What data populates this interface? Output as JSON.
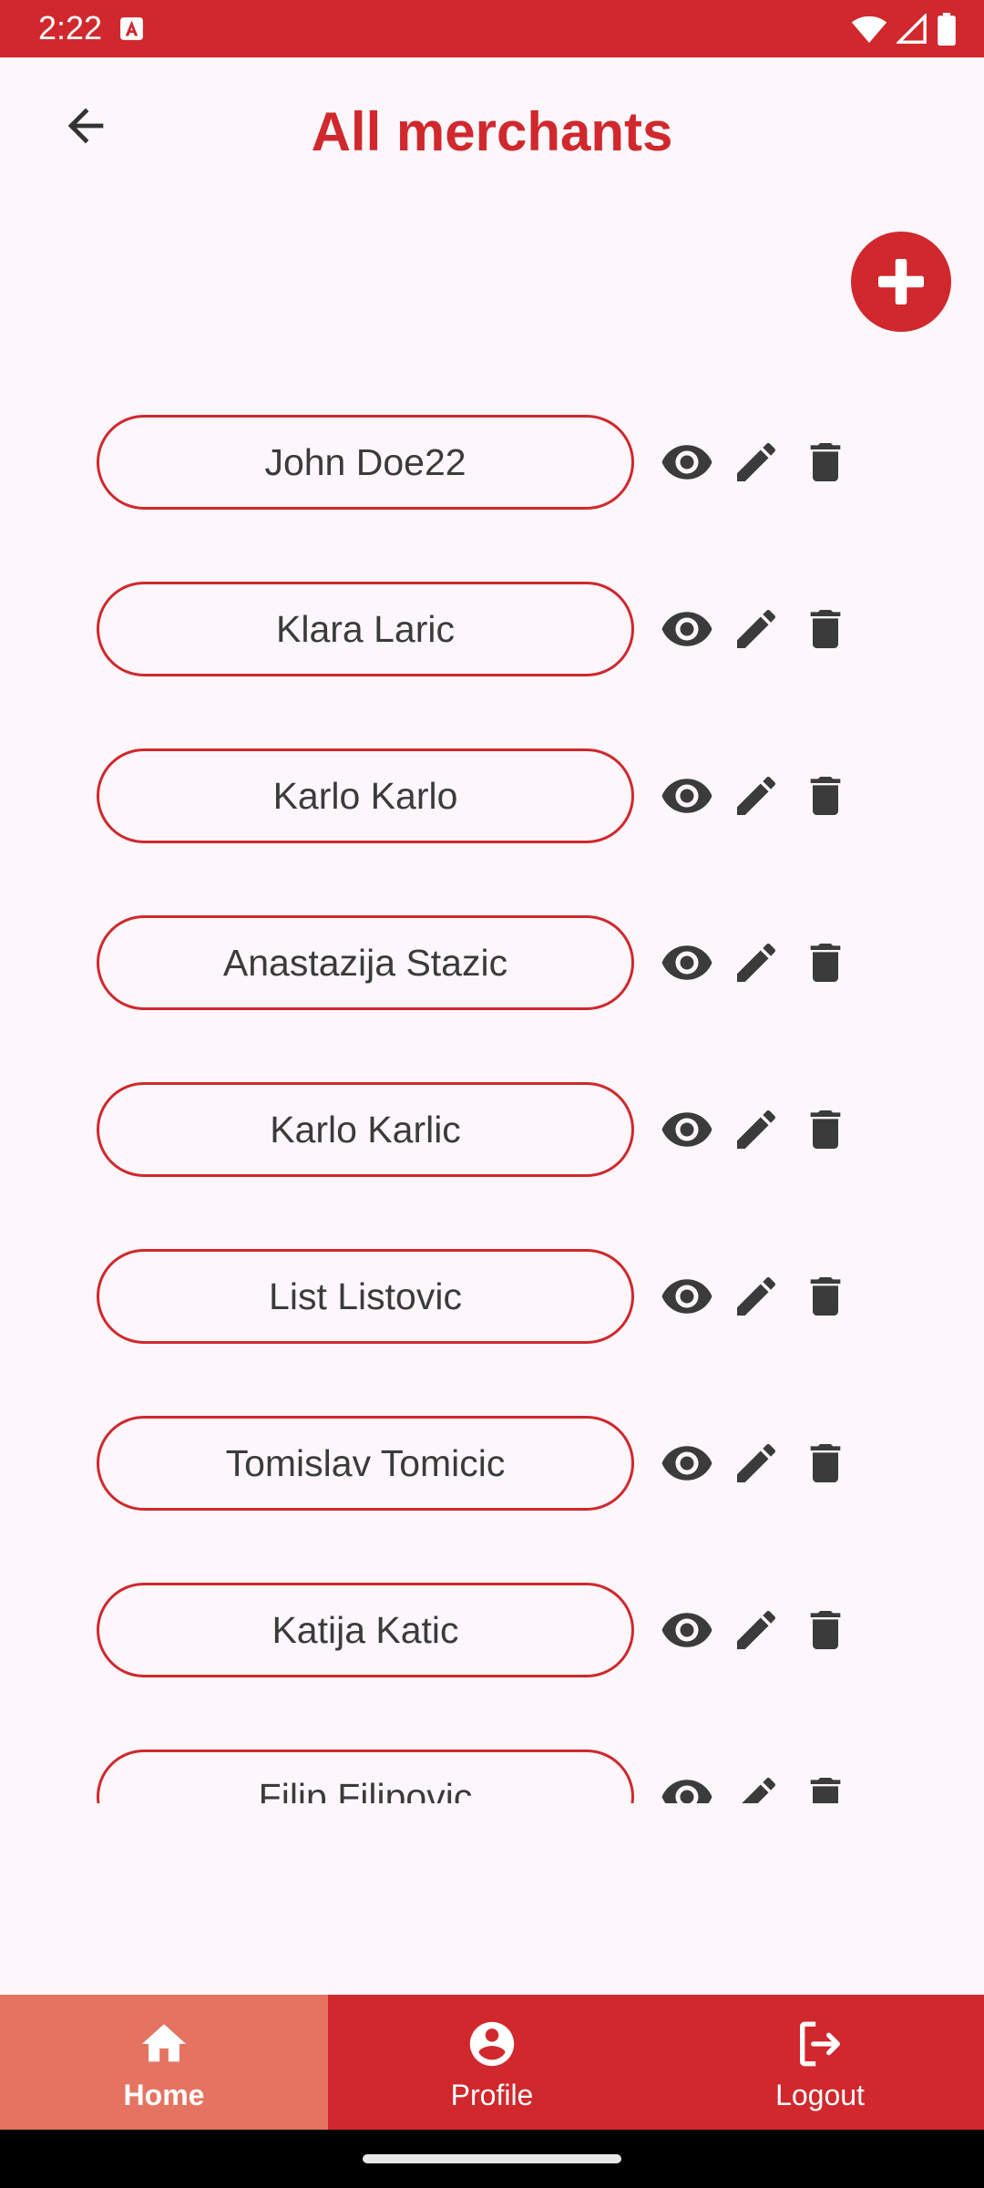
{
  "status_bar": {
    "time": "2:22",
    "background_color": "#d0282d",
    "icons": [
      "app-notification-icon",
      "wifi-icon",
      "cell-signal-icon",
      "battery-icon"
    ]
  },
  "header": {
    "title": "All merchants",
    "back_icon": "arrow-back-icon",
    "title_color": "#d0282d"
  },
  "fab": {
    "icon": "plus-icon",
    "color": "#d0282d"
  },
  "merchants": [
    {
      "name": "John Doe22"
    },
    {
      "name": "Klara Laric"
    },
    {
      "name": "Karlo Karlo"
    },
    {
      "name": "Anastazija Stazic"
    },
    {
      "name": "Karlo Karlic"
    },
    {
      "name": "List Listovic"
    },
    {
      "name": "Tomislav Tomicic"
    },
    {
      "name": "Katija Katic"
    },
    {
      "name": "Filip Filipovic"
    }
  ],
  "row_actions": [
    "view-eye-icon",
    "edit-pencil-icon",
    "delete-trash-icon"
  ],
  "bottom_nav": {
    "items": [
      {
        "label": "Home",
        "icon": "home-icon",
        "active": true
      },
      {
        "label": "Profile",
        "icon": "account-circle-icon",
        "active": false
      },
      {
        "label": "Logout",
        "icon": "logout-icon",
        "active": false
      }
    ],
    "background_color": "#d0282d",
    "active_color": "#e57361"
  }
}
